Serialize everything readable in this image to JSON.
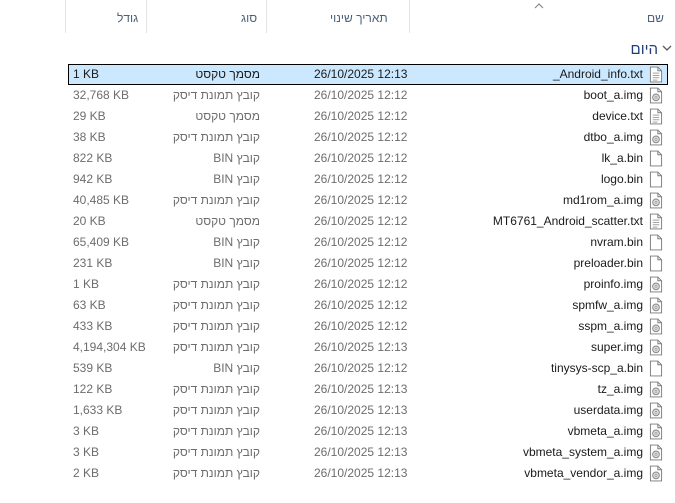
{
  "columns": {
    "name": "שם",
    "date": "תאריך שינוי",
    "type": "סוג",
    "size": "גודל"
  },
  "group": {
    "label": "היום"
  },
  "files": [
    {
      "name": "_Android_info.txt",
      "date": "26/10/2025 12:13",
      "type": "מסמך טקסט",
      "size": "1 KB",
      "icon": "text-file-icon",
      "selected": true
    },
    {
      "name": "boot_a.img",
      "date": "26/10/2025 12:12",
      "type": "קובץ תמונת דיסק",
      "size": "32,768 KB",
      "icon": "disk-image-icon"
    },
    {
      "name": "device.txt",
      "date": "26/10/2025 12:12",
      "type": "מסמך טקסט",
      "size": "29 KB",
      "icon": "text-file-icon"
    },
    {
      "name": "dtbo_a.img",
      "date": "26/10/2025 12:12",
      "type": "קובץ תמונת דיסק",
      "size": "38 KB",
      "icon": "disk-image-icon"
    },
    {
      "name": "lk_a.bin",
      "date": "26/10/2025 12:12",
      "type": "קובץ BIN",
      "size": "822 KB",
      "icon": "blank-file-icon"
    },
    {
      "name": "logo.bin",
      "date": "26/10/2025 12:12",
      "type": "קובץ BIN",
      "size": "942 KB",
      "icon": "blank-file-icon"
    },
    {
      "name": "md1rom_a.img",
      "date": "26/10/2025 12:12",
      "type": "קובץ תמונת דיסק",
      "size": "40,485 KB",
      "icon": "disk-image-icon"
    },
    {
      "name": "MT6761_Android_scatter.txt",
      "date": "26/10/2025 12:12",
      "type": "מסמך טקסט",
      "size": "20 KB",
      "icon": "text-file-icon"
    },
    {
      "name": "nvram.bin",
      "date": "26/10/2025 12:12",
      "type": "קובץ BIN",
      "size": "65,409 KB",
      "icon": "blank-file-icon"
    },
    {
      "name": "preloader.bin",
      "date": "26/10/2025 12:12",
      "type": "קובץ BIN",
      "size": "231 KB",
      "icon": "blank-file-icon"
    },
    {
      "name": "proinfo.img",
      "date": "26/10/2025 12:12",
      "type": "קובץ תמונת דיסק",
      "size": "1 KB",
      "icon": "disk-image-icon"
    },
    {
      "name": "spmfw_a.img",
      "date": "26/10/2025 12:12",
      "type": "קובץ תמונת דיסק",
      "size": "63 KB",
      "icon": "disk-image-icon"
    },
    {
      "name": "sspm_a.img",
      "date": "26/10/2025 12:12",
      "type": "קובץ תמונת דיסק",
      "size": "433 KB",
      "icon": "disk-image-icon"
    },
    {
      "name": "super.img",
      "date": "26/10/2025 12:13",
      "type": "קובץ תמונת דיסק",
      "size": "4,194,304 KB",
      "icon": "disk-image-icon"
    },
    {
      "name": "tinysys-scp_a.bin",
      "date": "26/10/2025 12:12",
      "type": "קובץ BIN",
      "size": "539 KB",
      "icon": "blank-file-icon"
    },
    {
      "name": "tz_a.img",
      "date": "26/10/2025 12:13",
      "type": "קובץ תמונת דיסק",
      "size": "122 KB",
      "icon": "disk-image-icon"
    },
    {
      "name": "userdata.img",
      "date": "26/10/2025 12:13",
      "type": "קובץ תמונת דיסק",
      "size": "1,633 KB",
      "icon": "disk-image-icon"
    },
    {
      "name": "vbmeta_a.img",
      "date": "26/10/2025 12:13",
      "type": "קובץ תמונת דיסק",
      "size": "3 KB",
      "icon": "disk-image-icon"
    },
    {
      "name": "vbmeta_system_a.img",
      "date": "26/10/2025 12:13",
      "type": "קובץ תמונת דיסק",
      "size": "3 KB",
      "icon": "disk-image-icon"
    },
    {
      "name": "vbmeta_vendor_a.img",
      "date": "26/10/2025 12:13",
      "type": "קובץ תמונת דיסק",
      "size": "2 KB",
      "icon": "disk-image-icon"
    }
  ]
}
